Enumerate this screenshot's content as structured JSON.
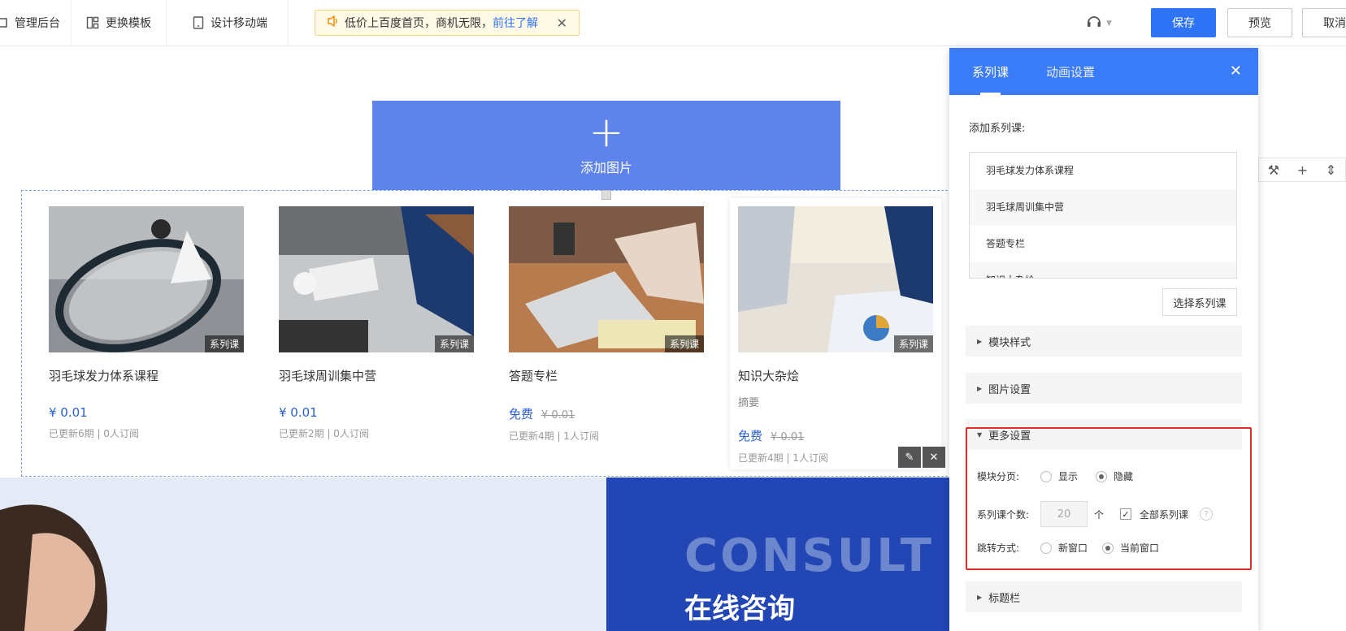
{
  "toolbar": {
    "admin_label": "管理后台",
    "template_label": "更换模板",
    "mobile_label": "设计移动端",
    "notice_text": "低价上百度首页，商机无限，",
    "notice_link": "前往了解",
    "save_label": "保存",
    "preview_label": "预览",
    "cancel_label": "取消"
  },
  "canvas": {
    "add_image_label": "添加图片",
    "consult_en": "CONSULT",
    "consult_zh": "在线咨询"
  },
  "courses": [
    {
      "title": "羽毛球发力体系课程",
      "tag": "系列课",
      "price": "¥ 0.01",
      "old_price": "",
      "meta": "已更新6期 | 0人订阅",
      "summary": ""
    },
    {
      "title": "羽毛球周训集中营",
      "tag": "系列课",
      "price": "¥ 0.01",
      "old_price": "",
      "meta": "已更新2期 | 0人订阅",
      "summary": ""
    },
    {
      "title": "答题专栏",
      "tag": "系列课",
      "price": "免费",
      "old_price": "¥ 0.01",
      "meta": "已更新4期 | 1人订阅",
      "summary": ""
    },
    {
      "title": "知识大杂烩",
      "tag": "系列课",
      "price": "免费",
      "old_price": "¥ 0.01",
      "meta": "已更新4期 | 1人订阅",
      "summary": "摘要"
    }
  ],
  "panel": {
    "tab1": "系列课",
    "tab2": "动画设置",
    "add_label": "添加系列课:",
    "list": [
      "羽毛球发力体系课程",
      "羽毛球周训集中营",
      "答题专栏",
      "知识大杂烩"
    ],
    "select_btn": "选择系列课",
    "sec_style": "模块样式",
    "sec_image": "图片设置",
    "sec_more": "更多设置",
    "sec_title": "标题栏",
    "paging_label": "模块分页:",
    "paging_show": "显示",
    "paging_hide": "隐藏",
    "count_label": "系列课个数:",
    "count_value": "20",
    "count_unit": "个",
    "all_label": "全部系列课",
    "jump_label": "跳转方式:",
    "jump_new": "新窗口",
    "jump_current": "当前窗口"
  }
}
